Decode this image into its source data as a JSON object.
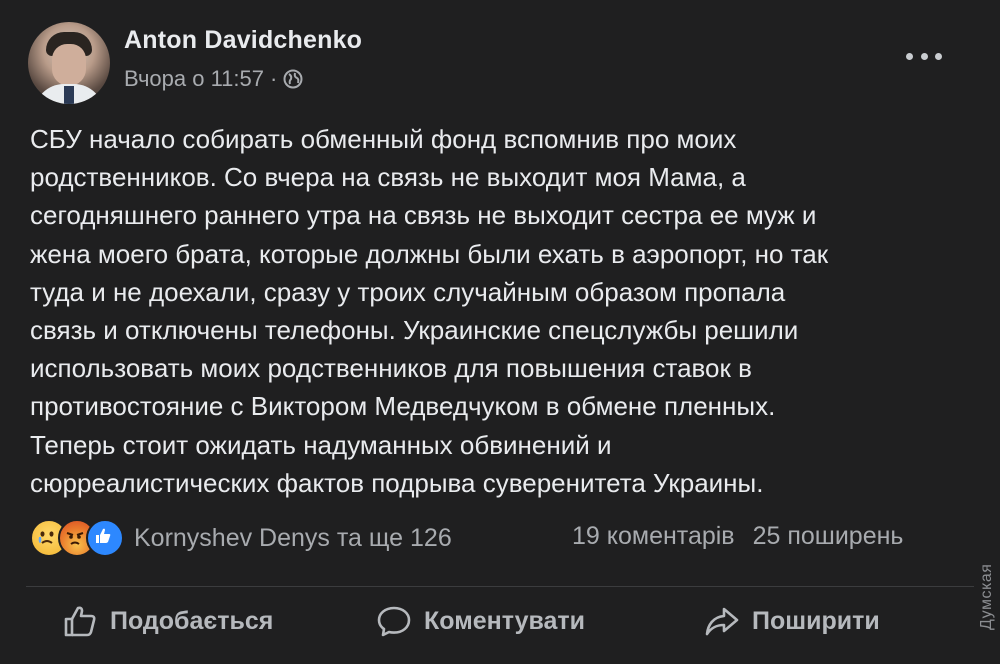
{
  "post": {
    "author": "Anton Davidchenko",
    "timestamp": "Вчора о 11:57",
    "meta_separator": "·",
    "privacy_icon": "globe-icon",
    "more_icon": "more-dots-icon",
    "text_lines": [
      "СБУ начало собирать обменный фонд вспомнив про моих",
      "родственников. Со вчера на связь не выходит моя Мама, а",
      "сегодняшнего раннего утра на связь не выходит сестра ее муж и",
      "жена моего брата, которые должны были ехать в аэропорт, но так",
      "туда и не доехали, сразу у троих случайным образом пропала",
      "связь и отключены телефоны. Украинские спецслужбы решили",
      "использовать моих родственников для повышения ставок в",
      "противостояние с Виктором Медведчуком в обмене пленных.",
      "Теперь стоит ожидать надуманных обвинений и",
      "сюрреалистических фактов подрыва суверенитета Украины."
    ]
  },
  "reactions": {
    "icons": [
      "sad-reaction-icon",
      "angry-reaction-icon",
      "like-reaction-icon"
    ],
    "summary": "Kornyshev Denys та ще 126",
    "comments": "19 коментарів",
    "shares": "25 поширень"
  },
  "actions": {
    "like": "Подобається",
    "comment": "Коментувати",
    "share": "Поширити"
  },
  "watermark": "Думская",
  "colors": {
    "background": "#1f1f20",
    "text": "#e9ebee",
    "secondary_text": "#a8abaf",
    "like_blue": "#2d88ff"
  }
}
